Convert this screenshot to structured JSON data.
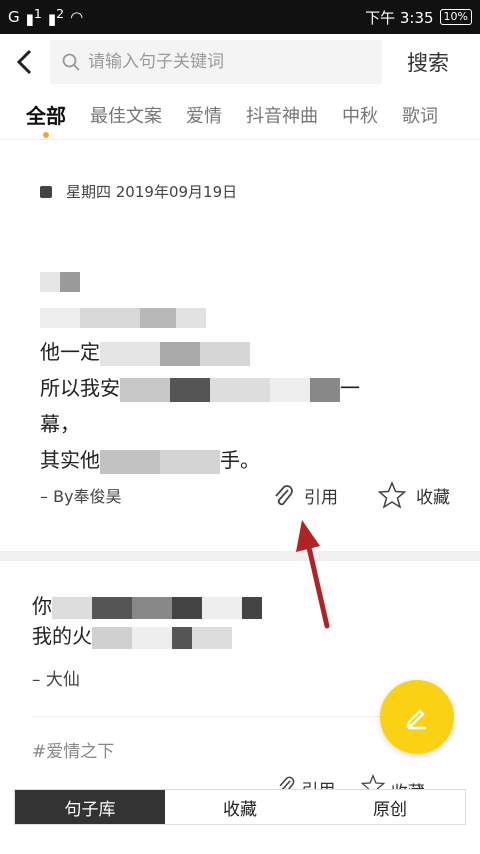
{
  "status": {
    "carrier_left": "G",
    "signal1": "1",
    "signal2": "2",
    "time": "下午 3:35",
    "battery": "10%"
  },
  "header": {
    "search_placeholder": "请输入句子关键词",
    "search_button": "搜索"
  },
  "tabs": [
    "全部",
    "最佳文案",
    "爱情",
    "抖音神曲",
    "中秋",
    "歌词"
  ],
  "card1": {
    "date": "星期四 2019年09月19日",
    "line_a": "他一定",
    "line_b": "所以我安",
    "line_b_end": "一",
    "line_c": "幕，",
    "line_d": "其实他",
    "line_d_end": "手。",
    "author": "– By奉俊昊",
    "cite": "引用",
    "collect": "收藏"
  },
  "card2": {
    "line_a": "你",
    "line_b": "我的火",
    "author": "– 大仙",
    "tag": "#爱情之下",
    "cite": "引用",
    "collect": "收藏"
  },
  "bottom_nav": [
    "句子库",
    "收藏",
    "原创"
  ],
  "colors": {
    "accent": "#fbd113",
    "dot": "#f5a623",
    "arrow": "#b22222"
  }
}
